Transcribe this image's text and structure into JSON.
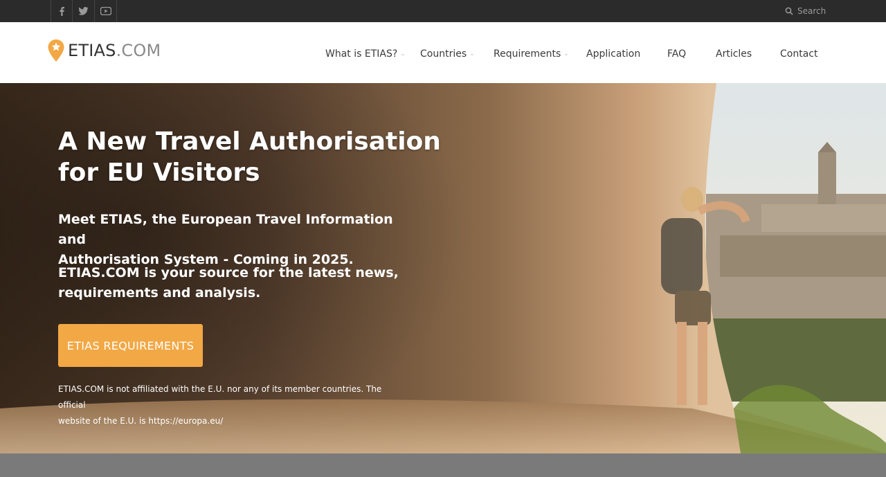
{
  "topbar": {
    "social": [
      {
        "icon": "facebook-icon",
        "glyph": "f"
      },
      {
        "icon": "twitter-icon",
        "glyph": "t"
      },
      {
        "icon": "youtube-icon",
        "glyph": "▶"
      }
    ],
    "search_label": "Search"
  },
  "header": {
    "logo_main": "ETIAS",
    "logo_suffix": ".COM",
    "nav": [
      {
        "label": "What is ETIAS?",
        "has_dropdown": true
      },
      {
        "label": "Countries",
        "has_dropdown": true
      },
      {
        "label": "Requirements",
        "has_dropdown": true
      },
      {
        "label": "Application",
        "has_dropdown": false
      },
      {
        "label": "FAQ",
        "has_dropdown": false
      },
      {
        "label": "Articles",
        "has_dropdown": false
      },
      {
        "label": "Contact",
        "has_dropdown": false
      }
    ]
  },
  "hero": {
    "title_line1": "A New Travel Authorisation",
    "title_line2": "for EU Visitors",
    "p1_line1": "Meet ETIAS, the European Travel Information and",
    "p1_line2": "Authorisation System - Coming in 2025.",
    "p2_line1": "ETIAS.COM is your source for the latest news,",
    "p2_line2": "requirements and analysis.",
    "cta_label": "ETIAS REQUIREMENTS",
    "disclaimer_line1": "ETIAS.COM is not affiliated with the E.U. nor any of its member countries. The official",
    "disclaimer_line2": "website of the E.U. is https://europa.eu/"
  },
  "colors": {
    "accent": "#f2a845",
    "topbar": "#2b2b2b",
    "logo_pin": "#f2a845"
  }
}
